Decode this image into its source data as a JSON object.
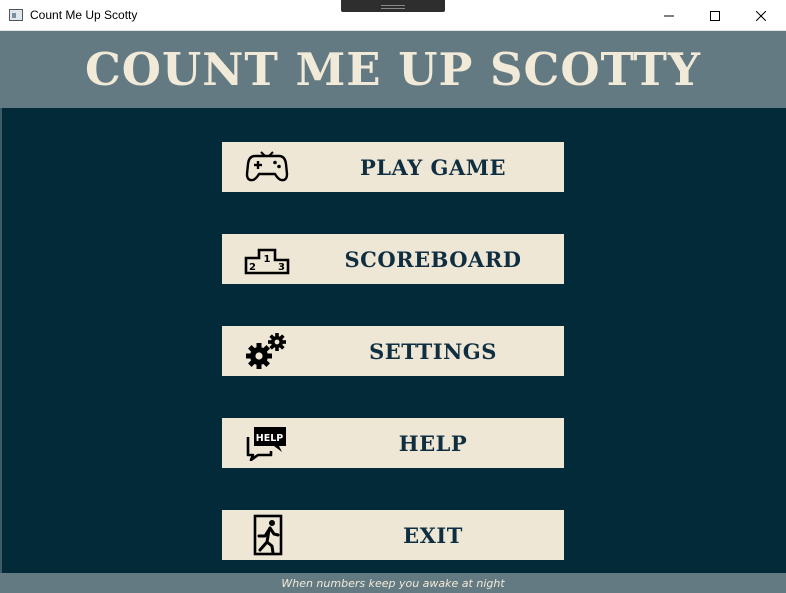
{
  "window": {
    "title": "Count Me Up Scotty",
    "icon": "app-window-icon",
    "controls": [
      "minimize-icon",
      "maximize-icon",
      "close-icon"
    ]
  },
  "header": {
    "title": "Count Me Up Scotty"
  },
  "menu": [
    {
      "label": "Play Game",
      "icon": "gamepad-icon"
    },
    {
      "label": "Scoreboard",
      "icon": "podium-icon"
    },
    {
      "label": "Settings",
      "icon": "gears-icon"
    },
    {
      "label": "Help",
      "icon": "help-bubble-icon"
    },
    {
      "label": "Exit",
      "icon": "exit-door-icon"
    }
  ],
  "footer": {
    "tagline": "When numbers keep you awake at night"
  },
  "colors": {
    "background": "#032a38",
    "header": "#637a83",
    "button": "#efe7d6",
    "button_text": "#0f2f41",
    "title_text": "#f2ead8"
  }
}
